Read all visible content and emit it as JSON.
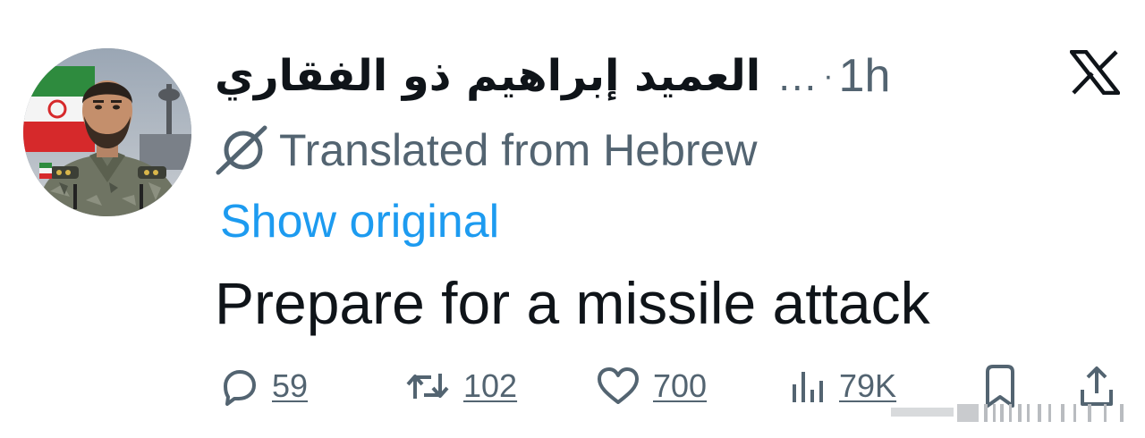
{
  "tweet": {
    "display_name": "العميد إبراهيم ذو الفقاري",
    "ellipsis": "…",
    "separator": "·",
    "time": "1h",
    "translated_label": "Translated from Hebrew",
    "show_original_label": "Show original",
    "text": "Prepare for a missile attack"
  },
  "actions": {
    "replies": "59",
    "retweets": "102",
    "likes": "700",
    "views": "79K"
  },
  "icons": {
    "avatar": "avatar-photo",
    "platform": "x-logo-icon",
    "translate": "translate-globe-icon",
    "reply": "reply-icon",
    "retweet": "retweet-icon",
    "like": "heart-icon",
    "views": "views-chart-icon",
    "bookmark": "bookmark-icon",
    "share": "share-icon"
  },
  "colors": {
    "text": "#0f1419",
    "secondary": "#536471",
    "link": "#1d9bf0",
    "background": "#ffffff"
  }
}
